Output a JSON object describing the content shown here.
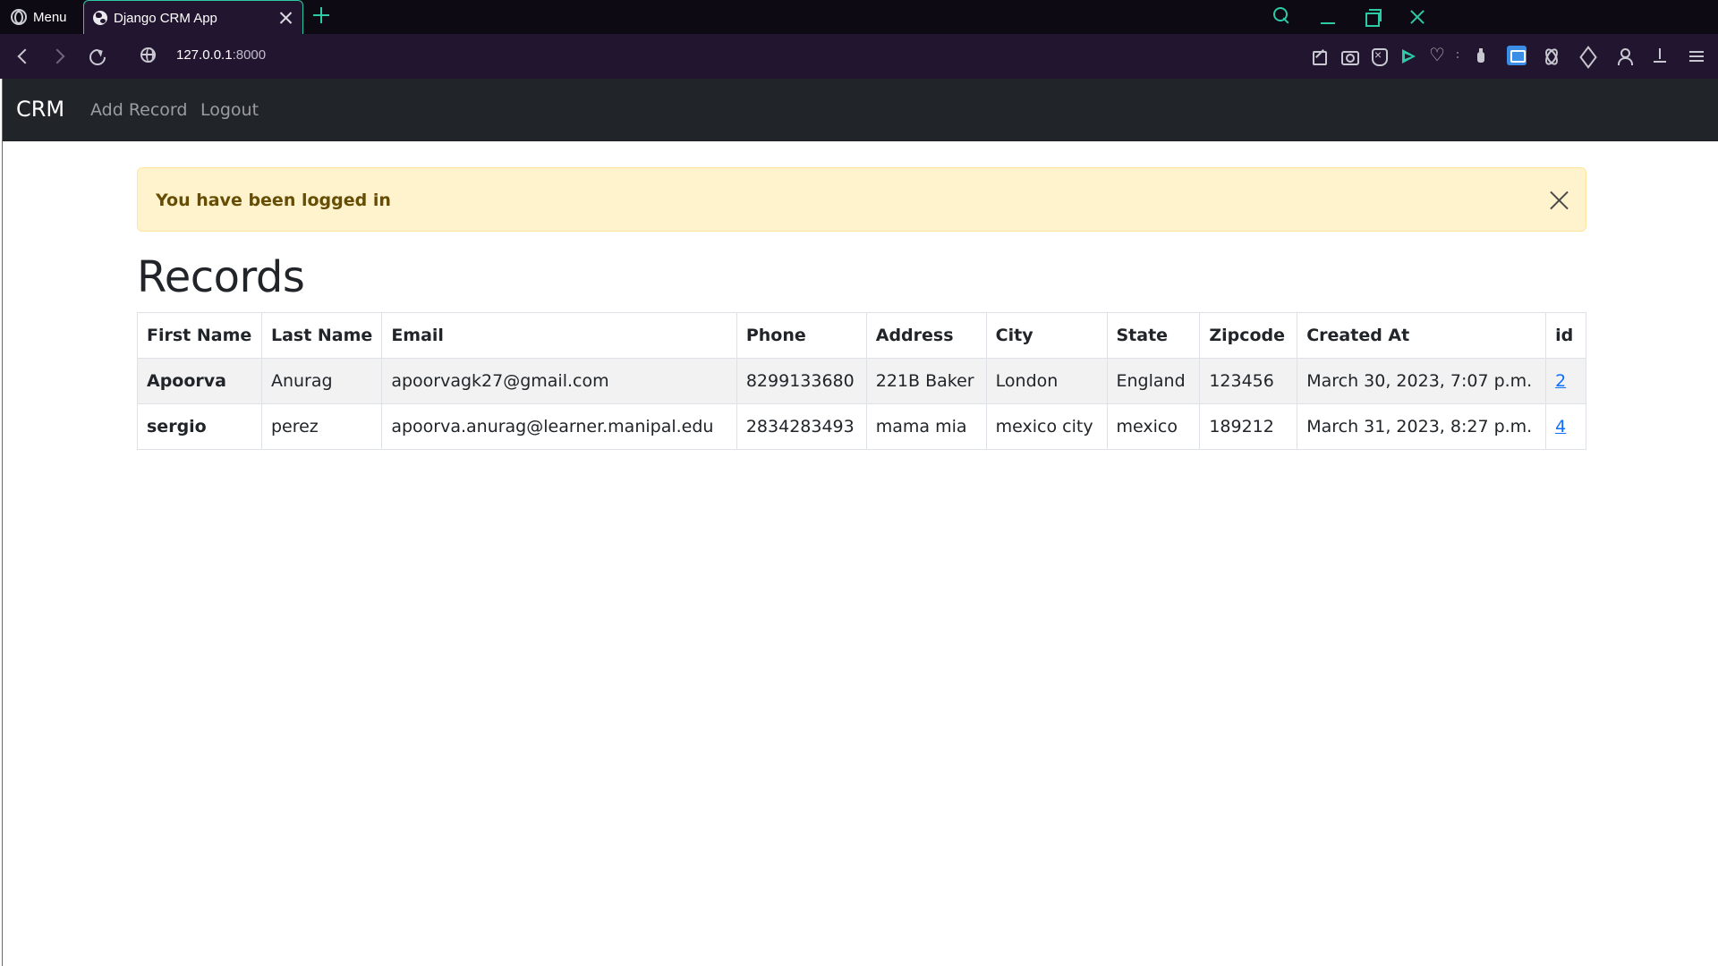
{
  "browser": {
    "menu_label": "Menu",
    "tab_title": "Django CRM App",
    "url_host": "127.0.0.1",
    "url_port": ":8000"
  },
  "navbar": {
    "brand": "CRM",
    "links": [
      "Add Record",
      "Logout"
    ]
  },
  "alert": {
    "message": "You have been logged in",
    "color": "#fff3cd"
  },
  "heading": "Records",
  "table": {
    "headers": [
      "First Name",
      "Last Name",
      "Email",
      "Phone",
      "Address",
      "City",
      "State",
      "Zipcode",
      "Created At",
      "id"
    ],
    "rows": [
      {
        "first_name": "Apoorva",
        "last_name": "Anurag",
        "email": "apoorvagk27@gmail.com",
        "phone": "8299133680",
        "address": "221B Baker",
        "city": "London",
        "state": "England",
        "zipcode": "123456",
        "created_at": "March 30, 2023, 7:07 p.m.",
        "id": "2"
      },
      {
        "first_name": "sergio",
        "last_name": "perez",
        "email": "apoorva.anurag@learner.manipal.edu",
        "phone": "2834283493",
        "address": "mama mia",
        "city": "mexico city",
        "state": "mexico",
        "zipcode": "189212",
        "created_at": "March 31, 2023, 8:27 p.m.",
        "id": "4"
      }
    ]
  },
  "icons": {
    "tab_bar": [
      "opera-logo-icon",
      "globe-icon",
      "close-icon",
      "plus-icon"
    ],
    "window": [
      "search-icon",
      "minimize-icon",
      "restore-icon",
      "close-icon"
    ],
    "toolbar": [
      "back-icon",
      "forward-icon",
      "reload-icon",
      "site-info-icon",
      "edit-icon",
      "camera-icon",
      "shield-icon",
      "send-icon",
      "heart-icon",
      "bottle-icon",
      "vpn-icon",
      "atom-icon",
      "box-icon",
      "user-icon",
      "download-icon",
      "settings-icon"
    ]
  },
  "colors": {
    "navbar_bg": "#212529",
    "browser_accent": "#2ec9a5",
    "link": "#0d6efd",
    "alert_text": "#664d03"
  }
}
